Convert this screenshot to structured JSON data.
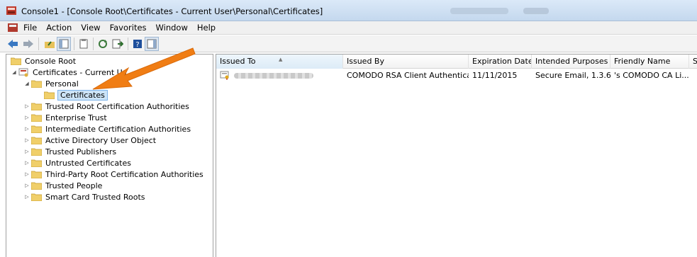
{
  "window": {
    "title": "Console1 - [Console Root\\Certificates - Current User\\Personal\\Certificates]"
  },
  "menu": {
    "items": [
      "File",
      "Action",
      "View",
      "Favorites",
      "Window",
      "Help"
    ]
  },
  "toolbar": {
    "buttons": [
      "back-icon",
      "forward-icon",
      "up-folder-icon",
      "show-hide-tree-icon",
      "copy-icon",
      "refresh-icon",
      "export-list-icon",
      "help-icon",
      "show-hide-action-pane-icon"
    ]
  },
  "tree": {
    "nodes": [
      {
        "label": "Console Root"
      },
      {
        "label": "Certificates - Current Us"
      },
      {
        "label": "Personal"
      },
      {
        "label": "Certificates"
      },
      {
        "label": "Trusted Root Certification Authorities"
      },
      {
        "label": "Enterprise Trust"
      },
      {
        "label": "Intermediate Certification Authorities"
      },
      {
        "label": "Active Directory User Object"
      },
      {
        "label": "Trusted Publishers"
      },
      {
        "label": "Untrusted Certificates"
      },
      {
        "label": "Third-Party Root Certification Authorities"
      },
      {
        "label": "Trusted People"
      },
      {
        "label": "Smart Card Trusted Roots"
      }
    ]
  },
  "list": {
    "columns": [
      "Issued To",
      "Issued By",
      "Expiration Date",
      "Intended Purposes",
      "Friendly Name",
      "St"
    ],
    "rows": [
      {
        "issued_by": "COMODO RSA Client Authenticat...",
        "expiration": "11/11/2015",
        "purposes": "Secure Email, 1.3.6....",
        "friendly_name": "'s COMODO CA Li..."
      }
    ]
  },
  "colors": {
    "selection": "#cce4f7",
    "annotation_arrow": "#f07d14",
    "titlebar": "#c4d8ee"
  }
}
